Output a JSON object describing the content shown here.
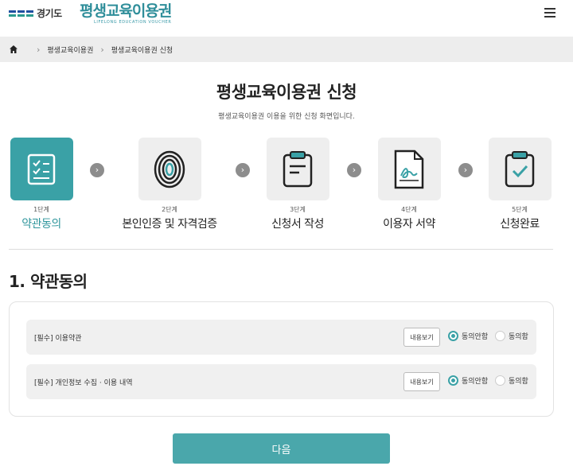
{
  "header": {
    "gov_logo_text": "경기도",
    "brand_title": "평생교육이용권",
    "brand_subtitle": "LIFELONG EDUCATION VOUCHER"
  },
  "breadcrumb": {
    "items": [
      "평생교육이용권",
      "평생교육이용권 신청"
    ]
  },
  "page": {
    "title": "평생교육이용권 신청",
    "subtitle": "평생교육이용권 이용을 위한 신청 화면입니다."
  },
  "steps": [
    {
      "num": "1단계",
      "label": "약관동의",
      "icon": "checklist-icon",
      "active": true
    },
    {
      "num": "2단계",
      "label": "본인인증 및 자격검증",
      "icon": "fingerprint-icon",
      "active": false
    },
    {
      "num": "3단계",
      "label": "신청서 작성",
      "icon": "clipboard-form-icon",
      "active": false
    },
    {
      "num": "4단계",
      "label": "이용자 서약",
      "icon": "signed-document-icon",
      "active": false
    },
    {
      "num": "5단계",
      "label": "신청완료",
      "icon": "clipboard-check-icon",
      "active": false
    }
  ],
  "section": {
    "title": "1. 약관동의"
  },
  "terms": [
    {
      "label": "[필수] 이용약관",
      "view_label": "내용보기",
      "disagree_label": "동의안함",
      "agree_label": "동의함",
      "selected": "disagree"
    },
    {
      "label": "[필수] 개인정보 수집 · 이용 내역",
      "view_label": "내용보기",
      "disagree_label": "동의안함",
      "agree_label": "동의함",
      "selected": "disagree"
    }
  ],
  "actions": {
    "next_label": "다음"
  },
  "colors": {
    "accent": "#3aa1a6",
    "button": "#4aa7ab"
  }
}
